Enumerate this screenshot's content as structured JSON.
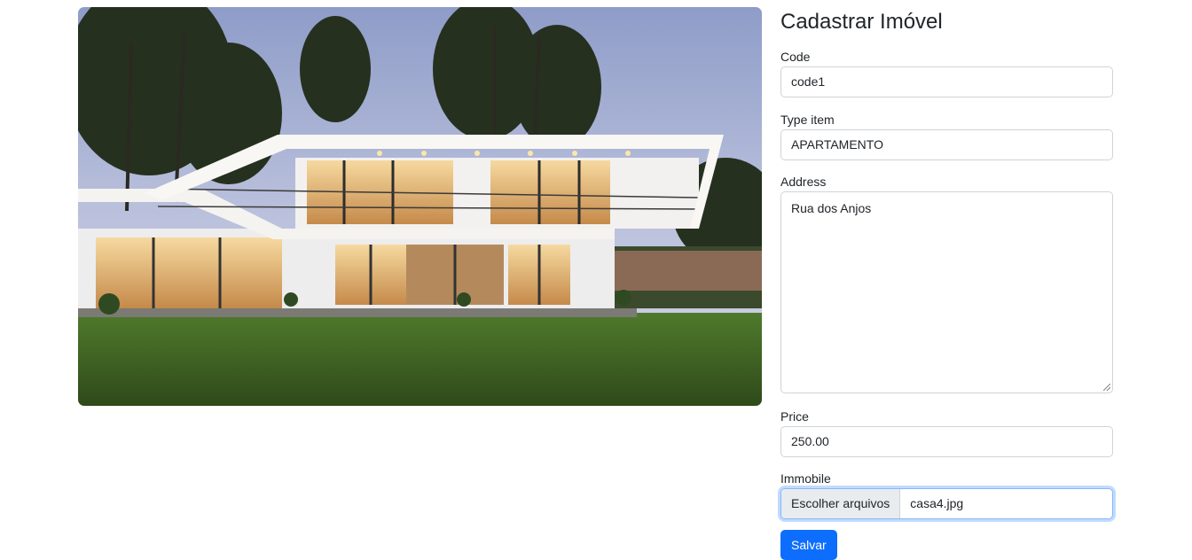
{
  "page": {
    "title": "Cadastrar Imóvel"
  },
  "form": {
    "code": {
      "label": "Code",
      "value": "code1"
    },
    "type_item": {
      "label": "Type item",
      "value": "APARTAMENTO"
    },
    "address": {
      "label": "Address",
      "value": "Rua dos Anjos"
    },
    "price": {
      "label": "Price",
      "value": "250.00"
    },
    "immobile": {
      "label": "Immobile",
      "button_label": "Escolher arquivos",
      "file_name": "casa4.jpg"
    },
    "submit_label": "Salvar"
  },
  "colors": {
    "primary": "#0d6efd",
    "border": "#ced4da",
    "focus_border": "#86b7fe",
    "file_button_bg": "#e9ecef"
  }
}
